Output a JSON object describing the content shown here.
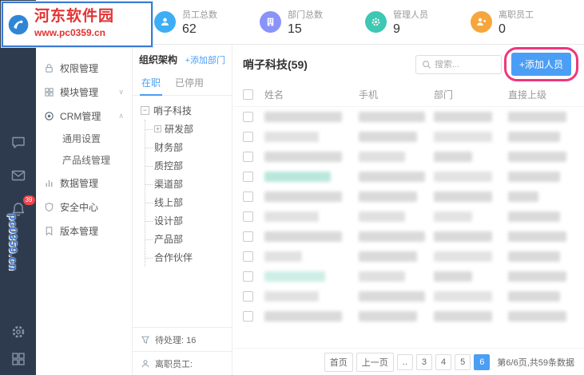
{
  "watermark": {
    "site_name": "河东软件园",
    "site_url": "www.pc0359.cn",
    "side_text": "pc0359.cn"
  },
  "topbar": {
    "stats": [
      {
        "label": "员工总数",
        "value": "62",
        "color": "#3daef6",
        "icon": "employees-icon"
      },
      {
        "label": "部门总数",
        "value": "15",
        "color": "#8a93f8",
        "icon": "departments-icon"
      },
      {
        "label": "管理人员",
        "value": "9",
        "color": "#3ec7b3",
        "icon": "managers-icon"
      },
      {
        "label": "离职员工",
        "value": "0",
        "color": "#f6a63c",
        "icon": "departed-icon"
      }
    ]
  },
  "sidebar": {
    "badge_count": "39",
    "icons": [
      "chat-icon",
      "mail-icon",
      "bell-icon",
      "gear-icon",
      "apps-grid-icon"
    ]
  },
  "menu": {
    "items": [
      {
        "label": "权限管理",
        "icon": "lock-icon"
      },
      {
        "label": "模块管理",
        "icon": "modules-icon",
        "chevron": "down"
      },
      {
        "label": "CRM管理",
        "icon": "crm-icon",
        "chevron": "up",
        "expanded": true
      },
      {
        "label": "通用设置",
        "sub": true
      },
      {
        "label": "产品线管理",
        "sub": true
      },
      {
        "label": "数据管理",
        "icon": "data-icon"
      },
      {
        "label": "安全中心",
        "icon": "shield-icon"
      },
      {
        "label": "版本管理",
        "icon": "version-icon"
      }
    ]
  },
  "org": {
    "title": "组织架构",
    "add_label": "+添加部门",
    "tabs": [
      {
        "label": "在职",
        "active": true
      },
      {
        "label": "已停用",
        "active": false
      }
    ],
    "root": "哨子科技",
    "children": [
      "研发部",
      "财务部",
      "质控部",
      "渠道部",
      "线上部",
      "设计部",
      "产品部",
      "合作伙伴"
    ],
    "pending": "待处理: 16",
    "resigned": "离职员工:"
  },
  "main": {
    "title": "哨子科技(59)",
    "search_placeholder": "搜索...",
    "add_button": "+添加人员",
    "annotation_color": "#f0367c",
    "columns": [
      "姓名",
      "手机",
      "部门",
      "直接上级"
    ],
    "row_count": 11,
    "pagination": {
      "first": "首页",
      "prev": "上一页",
      "ellipsis": "..",
      "pages": [
        "3",
        "4",
        "5",
        "6"
      ],
      "active_page": "6",
      "summary": "第6/6页,共59条数据"
    }
  },
  "colors": {
    "accent_blue": "#4b9ef5",
    "dark_sidebar": "#2e3b4e",
    "badge_red": "#f0464b"
  }
}
